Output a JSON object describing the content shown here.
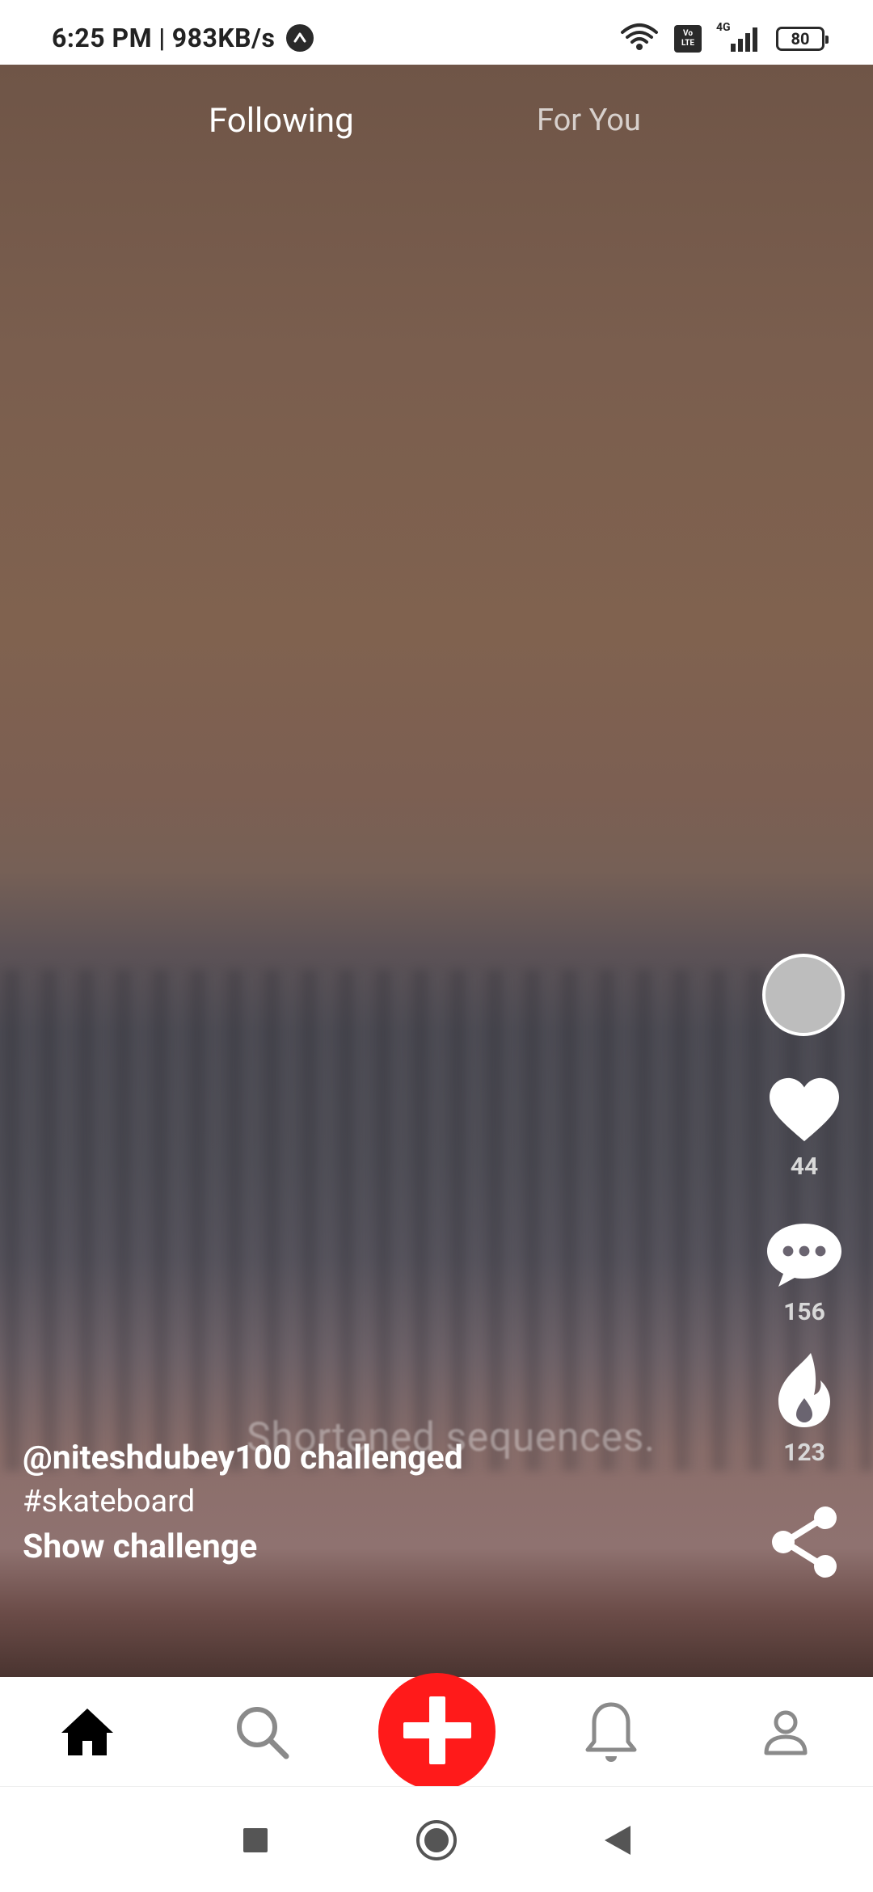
{
  "status_bar": {
    "time": "6:25 PM",
    "separator": "|",
    "speed": "983KB/s",
    "volte_top": "Vo",
    "volte_bottom": "LTE",
    "network": "4G",
    "battery": "80"
  },
  "tabs": {
    "following": "Following",
    "for_you": "For You"
  },
  "video": {
    "subtitle_overlay": "Shortened sequences."
  },
  "actions": {
    "likes": "44",
    "comments": "156",
    "fire": "123"
  },
  "caption": {
    "user_line": "@niteshdubey100 challenged",
    "hashtag": "#skateboard",
    "show_challenge": "Show challenge"
  },
  "colors": {
    "accent_red": "#ff1a1a",
    "text_white": "#ffffff",
    "count_gray": "#d8d8d8"
  },
  "icons": {
    "nav": [
      "home-icon",
      "search-icon",
      "add-icon",
      "bell-icon",
      "profile-icon"
    ],
    "system": [
      "recents-icon",
      "home-circle-icon",
      "back-icon"
    ],
    "actions": [
      "heart-icon",
      "comment-icon",
      "fire-icon",
      "share-icon"
    ]
  }
}
